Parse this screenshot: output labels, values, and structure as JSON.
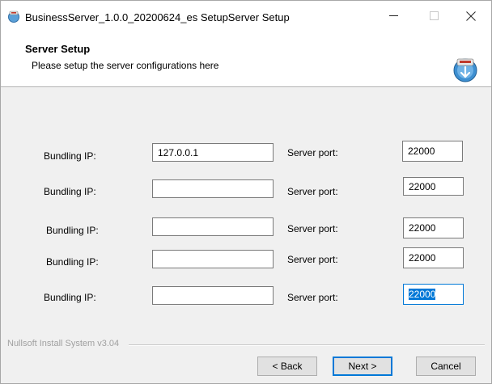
{
  "window": {
    "title": "BusinessServer_1.0.0_20200624_es SetupServer Setup",
    "icons": {
      "app": "setup-icon",
      "minimize": "minimize-icon",
      "maximize": "maximize-icon",
      "close": "close-icon"
    }
  },
  "header": {
    "title": "Server Setup",
    "subtitle": "Please setup the server configurations here",
    "icon": "installer-icon"
  },
  "form": {
    "rows": [
      {
        "ip_label": "Bundling IP:",
        "ip_value": "127.0.0.1",
        "port_label": "Server port:",
        "port_value": "22000"
      },
      {
        "ip_label": "Bundling IP:",
        "ip_value": "",
        "port_label": "Server port:",
        "port_value": "22000"
      },
      {
        "ip_label": "Bundling IP:",
        "ip_value": "",
        "port_label": "Server port:",
        "port_value": "22000"
      },
      {
        "ip_label": "Bundling IP:",
        "ip_value": "",
        "port_label": "Server port:",
        "port_value": "22000"
      },
      {
        "ip_label": "Bundling IP:",
        "ip_value": "",
        "port_label": "Server port:",
        "port_value": "22000"
      }
    ]
  },
  "footer": {
    "branding": "Nullsoft Install System v3.04",
    "back_label": "< Back",
    "next_label": "Next >",
    "cancel_label": "Cancel"
  },
  "colors": {
    "accent": "#0078d7",
    "background": "#f0f0f0"
  }
}
